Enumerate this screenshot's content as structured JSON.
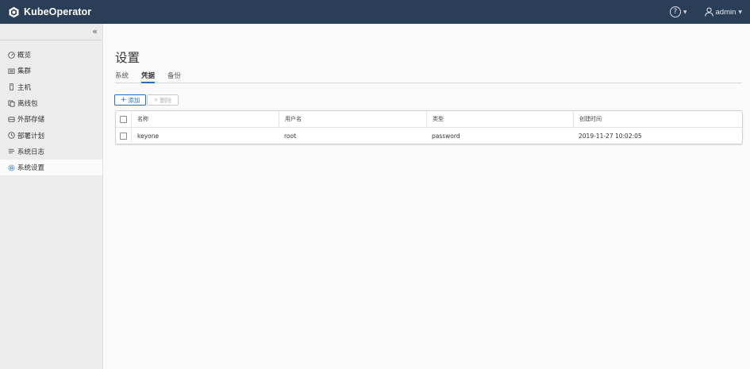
{
  "header": {
    "brand_name": "KubeOperator",
    "help_label": "?",
    "user_name": "admin"
  },
  "sidebar": {
    "collapse_label": "«",
    "items": [
      {
        "label": "概览",
        "icon": "dashboard-icon"
      },
      {
        "label": "集群",
        "icon": "cluster-icon"
      },
      {
        "label": "主机",
        "icon": "host-icon"
      },
      {
        "label": "离线包",
        "icon": "package-icon"
      },
      {
        "label": "外部存储",
        "icon": "storage-icon"
      },
      {
        "label": "部署计划",
        "icon": "plan-icon"
      },
      {
        "label": "系统日志",
        "icon": "log-icon"
      },
      {
        "label": "系统设置",
        "icon": "settings-icon",
        "active": true
      }
    ]
  },
  "main": {
    "title": "设置",
    "tabs": [
      "系统",
      "凭据",
      "备份"
    ],
    "active_tab": "凭据",
    "toolbar": {
      "add_label": "添加",
      "delete_label": "删除"
    },
    "table": {
      "columns": [
        "名称",
        "用户名",
        "类型",
        "创建时间"
      ],
      "rows": [
        [
          "keyone",
          "root",
          "password",
          "2019-11-27 10:02:05"
        ]
      ]
    }
  },
  "colors": {
    "header_bg": "#2b3e58",
    "accent": "#1d72c5",
    "sidebar_bg": "#ececec",
    "page_bg": "#fafafa"
  }
}
